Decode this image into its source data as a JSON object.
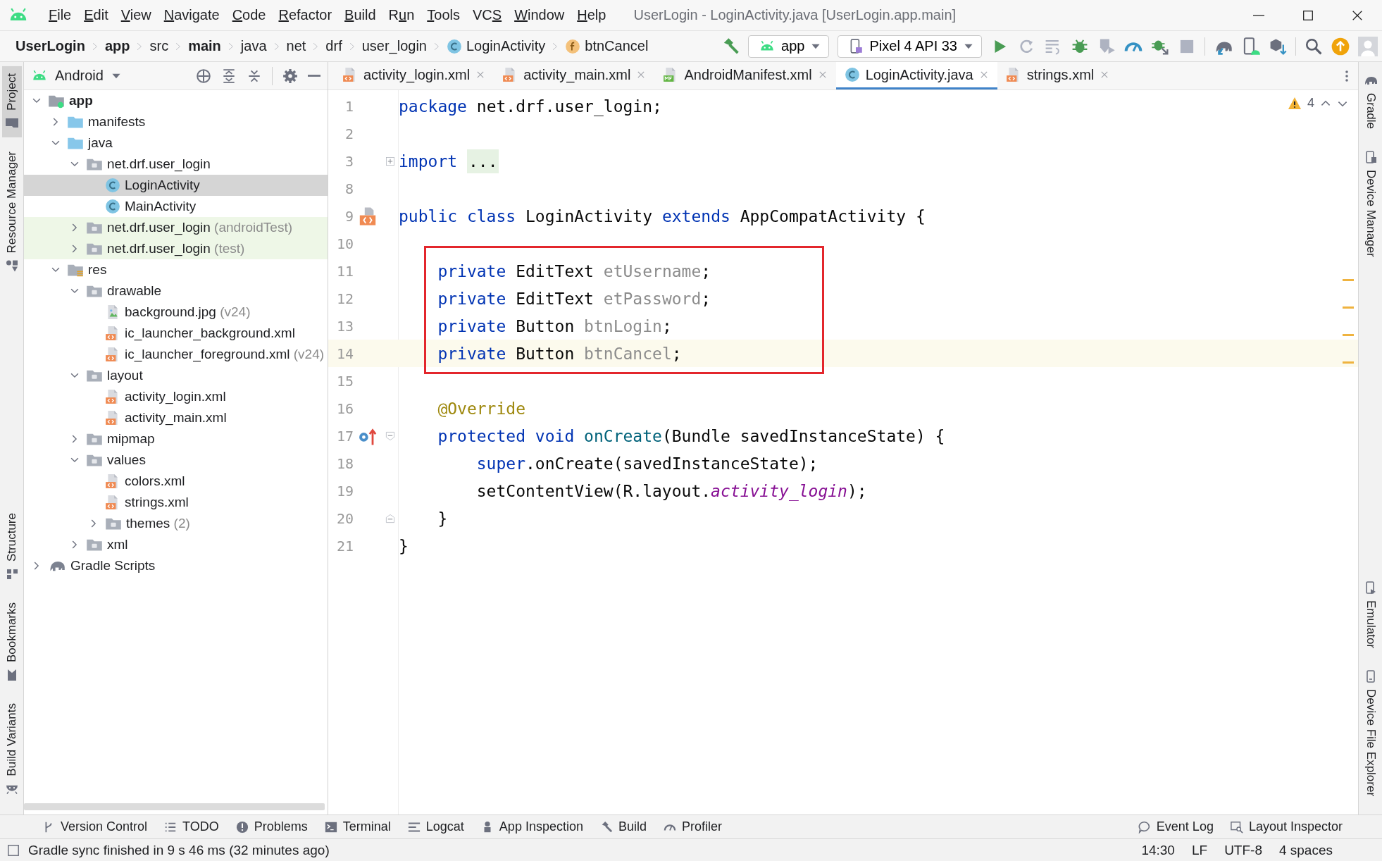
{
  "window": {
    "title": "UserLogin - LoginActivity.java [UserLogin.app.main]"
  },
  "menu": [
    {
      "parts": [
        {
          "text": "F",
          "underlined": true
        },
        {
          "text": "ile",
          "underlined": false
        }
      ]
    },
    {
      "parts": [
        {
          "text": "E",
          "underlined": true
        },
        {
          "text": "dit",
          "underlined": false
        }
      ]
    },
    {
      "parts": [
        {
          "text": "V",
          "underlined": true
        },
        {
          "text": "iew",
          "underlined": false
        }
      ]
    },
    {
      "parts": [
        {
          "text": "N",
          "underlined": true
        },
        {
          "text": "avigate",
          "underlined": false
        }
      ]
    },
    {
      "parts": [
        {
          "text": "C",
          "underlined": true
        },
        {
          "text": "ode",
          "underlined": false
        }
      ]
    },
    {
      "parts": [
        {
          "text": "R",
          "underlined": true
        },
        {
          "text": "efactor",
          "underlined": false
        }
      ]
    },
    {
      "parts": [
        {
          "text": "B",
          "underlined": true
        },
        {
          "text": "uild",
          "underlined": false
        }
      ]
    },
    {
      "parts": [
        {
          "text": "R",
          "underlined": false
        },
        {
          "text": "u",
          "underlined": true
        },
        {
          "text": "n",
          "underlined": false
        }
      ]
    },
    {
      "parts": [
        {
          "text": "T",
          "underlined": true
        },
        {
          "text": "ools",
          "underlined": false
        }
      ]
    },
    {
      "parts": [
        {
          "text": "VC",
          "underlined": false
        },
        {
          "text": "S",
          "underlined": true
        }
      ]
    },
    {
      "parts": [
        {
          "text": "W",
          "underlined": true
        },
        {
          "text": "indow",
          "underlined": false
        }
      ]
    },
    {
      "parts": [
        {
          "text": "H",
          "underlined": true
        },
        {
          "text": "elp",
          "underlined": false
        }
      ]
    }
  ],
  "breadcrumbs": [
    {
      "label": "UserLogin",
      "kind": "plain",
      "bold": true
    },
    {
      "label": "app",
      "kind": "plain",
      "bold": true
    },
    {
      "label": "src",
      "kind": "plain",
      "bold": false
    },
    {
      "label": "main",
      "kind": "plain",
      "bold": true
    },
    {
      "label": "java",
      "kind": "plain",
      "bold": false
    },
    {
      "label": "net",
      "kind": "plain",
      "bold": false
    },
    {
      "label": "drf",
      "kind": "plain",
      "bold": false
    },
    {
      "label": "user_login",
      "kind": "plain",
      "bold": false
    },
    {
      "label": "LoginActivity",
      "kind": "class",
      "bold": false
    },
    {
      "label": "btnCancel",
      "kind": "field",
      "bold": false
    }
  ],
  "toolbar": [
    {
      "kind": "hammer",
      "disabled": false
    },
    {
      "kind": "module-config",
      "label": "app"
    },
    {
      "kind": "device-config",
      "label": "Pixel 4 API 33"
    },
    {
      "kind": "run",
      "disabled": false
    },
    {
      "kind": "rerun",
      "disabled": true
    },
    {
      "kind": "apply",
      "disabled": true
    },
    {
      "kind": "debug",
      "disabled": false
    },
    {
      "kind": "attach",
      "disabled": true
    },
    {
      "kind": "profile",
      "disabled": false
    },
    {
      "kind": "attach-debugger",
      "disabled": false
    },
    {
      "kind": "stop",
      "disabled": true
    },
    {
      "kind": "separator"
    },
    {
      "kind": "sync",
      "disabled": false
    },
    {
      "kind": "device-manager",
      "disabled": false
    },
    {
      "kind": "sdk",
      "disabled": false
    },
    {
      "kind": "separator"
    },
    {
      "kind": "search",
      "disabled": false
    },
    {
      "kind": "update",
      "disabled": false
    },
    {
      "kind": "account",
      "disabled": false
    }
  ],
  "left_strip": {
    "top": [
      {
        "label": "Project",
        "kind": "project",
        "selected": true
      },
      {
        "label": "Resource Manager",
        "kind": "resources",
        "selected": false
      }
    ],
    "bottom": [
      {
        "label": "Structure",
        "kind": "structure",
        "selected": false
      },
      {
        "label": "Bookmarks",
        "kind": "bookmarks",
        "selected": false
      },
      {
        "label": "Build Variants",
        "kind": "variants",
        "selected": false
      }
    ]
  },
  "right_strip": {
    "top": [
      {
        "label": "Gradle",
        "kind": "gradle",
        "selected": false
      },
      {
        "label": "Device Manager",
        "kind": "device",
        "selected": false
      }
    ],
    "bottom": [
      {
        "label": "Emulator",
        "kind": "emulator",
        "selected": false
      },
      {
        "label": "Device File Explorer",
        "kind": "files",
        "selected": false
      }
    ]
  },
  "project": {
    "view": "Android",
    "tree": [
      {
        "label": "app",
        "kind": "module",
        "bold": true,
        "expanded": true,
        "selected": false,
        "test": false,
        "children": [
          {
            "label": "manifests",
            "kind": "folder",
            "bold": false,
            "expanded": false,
            "selected": false,
            "test": false
          },
          {
            "label": "java",
            "kind": "folder",
            "bold": false,
            "expanded": true,
            "selected": false,
            "test": false,
            "children": [
              {
                "label": "net.drf.user_login",
                "kind": "package",
                "bold": false,
                "expanded": true,
                "selected": false,
                "test": false,
                "children": [
                  {
                    "label": "LoginActivity",
                    "kind": "class",
                    "bold": false,
                    "selected": true,
                    "test": false
                  },
                  {
                    "label": "MainActivity",
                    "kind": "class",
                    "bold": false,
                    "selected": false,
                    "test": false
                  }
                ]
              },
              {
                "label": "net.drf.user_login",
                "suffix": "(androidTest)",
                "kind": "package",
                "bold": false,
                "expanded": false,
                "selected": false,
                "test": true
              },
              {
                "label": "net.drf.user_login",
                "suffix": "(test)",
                "kind": "package",
                "bold": false,
                "expanded": false,
                "selected": false,
                "test": true
              }
            ]
          },
          {
            "label": "res",
            "kind": "resources",
            "bold": false,
            "expanded": true,
            "selected": false,
            "test": false,
            "children": [
              {
                "label": "drawable",
                "kind": "package",
                "bold": false,
                "expanded": true,
                "selected": false,
                "test": false,
                "children": [
                  {
                    "label": "background.jpg",
                    "suffix": "(v24)",
                    "kind": "image",
                    "bold": false,
                    "selected": false,
                    "test": false
                  },
                  {
                    "label": "ic_launcher_background.xml",
                    "kind": "xml",
                    "bold": false,
                    "selected": false,
                    "test": false
                  },
                  {
                    "label": "ic_launcher_foreground.xml",
                    "suffix": "(v24)",
                    "kind": "xml",
                    "bold": false,
                    "selected": false,
                    "test": false
                  }
                ]
              },
              {
                "label": "layout",
                "kind": "package",
                "bold": false,
                "expanded": true,
                "selected": false,
                "test": false,
                "children": [
                  {
                    "label": "activity_login.xml",
                    "kind": "xml",
                    "bold": false,
                    "selected": false,
                    "test": false
                  },
                  {
                    "label": "activity_main.xml",
                    "kind": "xml",
                    "bold": false,
                    "selected": false,
                    "test": false
                  }
                ]
              },
              {
                "label": "mipmap",
                "kind": "package",
                "bold": false,
                "expanded": false,
                "selected": false,
                "test": false
              },
              {
                "label": "values",
                "kind": "package",
                "bold": false,
                "expanded": true,
                "selected": false,
                "test": false,
                "children": [
                  {
                    "label": "colors.xml",
                    "kind": "xml",
                    "bold": false,
                    "selected": false,
                    "test": false
                  },
                  {
                    "label": "strings.xml",
                    "kind": "xml",
                    "bold": false,
                    "selected": false,
                    "test": false
                  },
                  {
                    "label": "themes",
                    "suffix": "(2)",
                    "kind": "package",
                    "bold": false,
                    "expanded": false,
                    "selected": false,
                    "test": false
                  }
                ]
              },
              {
                "label": "xml",
                "kind": "package",
                "bold": false,
                "expanded": false,
                "selected": false,
                "test": false
              }
            ]
          }
        ]
      },
      {
        "label": "Gradle Scripts",
        "kind": "gradle",
        "bold": false,
        "expanded": false,
        "selected": false,
        "test": false
      }
    ]
  },
  "tabs": [
    {
      "label": "activity_login.xml",
      "kind": "xml",
      "selected": false
    },
    {
      "label": "activity_main.xml",
      "kind": "xml",
      "selected": false
    },
    {
      "label": "AndroidManifest.xml",
      "kind": "manifest",
      "selected": false
    },
    {
      "label": "LoginActivity.java",
      "kind": "class",
      "selected": true
    },
    {
      "label": "strings.xml",
      "kind": "xml",
      "selected": false
    }
  ],
  "editor": {
    "warnings_count": "4",
    "lines": [
      {
        "number": "1",
        "current": false,
        "boxed": false,
        "warning": false,
        "tokens": [
          {
            "kind": "keyword",
            "text": "package"
          },
          {
            "kind": "plain",
            "text": " net.drf.user_login;"
          }
        ]
      },
      {
        "number": "2",
        "current": false,
        "boxed": false,
        "warning": false
      },
      {
        "number": "3",
        "current": false,
        "boxed": false,
        "warning": false,
        "fold": {
          "kind": "folded"
        },
        "tokens": [
          {
            "kind": "keyword",
            "text": "import "
          },
          {
            "kind": "folded",
            "text": "..."
          }
        ]
      },
      {
        "number": "8",
        "current": false,
        "boxed": false,
        "warning": false
      },
      {
        "number": "9",
        "current": false,
        "boxed": false,
        "warning": false,
        "gutter": {
          "kind": "implemented"
        },
        "tokens": [
          {
            "kind": "keyword",
            "text": "public class"
          },
          {
            "kind": "plain",
            "text": " LoginActivity "
          },
          {
            "kind": "keyword",
            "text": "extends"
          },
          {
            "kind": "plain",
            "text": " AppCompatActivity {"
          }
        ]
      },
      {
        "number": "10",
        "current": false,
        "boxed": false,
        "warning": false
      },
      {
        "number": "11",
        "current": false,
        "boxed": true,
        "warning": true,
        "tokens": [
          {
            "kind": "keyword",
            "text": "    private"
          },
          {
            "kind": "plain",
            "text": " EditText "
          },
          {
            "kind": "unused",
            "text": "etUsername"
          },
          {
            "kind": "plain",
            "text": ";"
          }
        ]
      },
      {
        "number": "12",
        "current": false,
        "boxed": true,
        "warning": true,
        "tokens": [
          {
            "kind": "keyword",
            "text": "    private"
          },
          {
            "kind": "plain",
            "text": " EditText "
          },
          {
            "kind": "unused",
            "text": "etPassword"
          },
          {
            "kind": "plain",
            "text": ";"
          }
        ]
      },
      {
        "number": "13",
        "current": false,
        "boxed": true,
        "warning": true,
        "tokens": [
          {
            "kind": "keyword",
            "text": "    private"
          },
          {
            "kind": "plain",
            "text": " Button "
          },
          {
            "kind": "unused",
            "text": "btnLogin"
          },
          {
            "kind": "plain",
            "text": ";"
          }
        ]
      },
      {
        "number": "14",
        "current": true,
        "boxed": true,
        "warning": true,
        "tokens": [
          {
            "kind": "keyword",
            "text": "    private"
          },
          {
            "kind": "plain",
            "text": " Button "
          },
          {
            "kind": "unused",
            "text": "btnCancel"
          },
          {
            "kind": "plain",
            "text": ";"
          }
        ]
      },
      {
        "number": "15",
        "current": false,
        "boxed": false,
        "warning": false
      },
      {
        "number": "16",
        "current": false,
        "boxed": false,
        "warning": false,
        "tokens": [
          {
            "kind": "annotation",
            "text": "    @Override"
          }
        ]
      },
      {
        "number": "17",
        "current": false,
        "boxed": false,
        "warning": false,
        "gutter": {
          "kind": "overrides"
        },
        "fold": {
          "kind": "open"
        },
        "tokens": [
          {
            "kind": "keyword",
            "text": "    protected void "
          },
          {
            "kind": "method",
            "text": "onCreate"
          },
          {
            "kind": "plain",
            "text": "(Bundle savedInstanceState) {"
          }
        ]
      },
      {
        "number": "18",
        "current": false,
        "boxed": false,
        "warning": false,
        "tokens": [
          {
            "kind": "keyword",
            "text": "        super"
          },
          {
            "kind": "plain",
            "text": ".onCreate(savedInstanceState);"
          }
        ]
      },
      {
        "number": "19",
        "current": false,
        "boxed": false,
        "warning": false,
        "tokens": [
          {
            "kind": "plain",
            "text": "        setContentView(R.layout."
          },
          {
            "kind": "static",
            "text": "activity_login"
          },
          {
            "kind": "plain",
            "text": ");"
          }
        ]
      },
      {
        "number": "20",
        "current": false,
        "boxed": false,
        "warning": false,
        "fold": {
          "kind": "close"
        },
        "tokens": [
          {
            "kind": "plain",
            "text": "    }"
          }
        ]
      },
      {
        "number": "21",
        "current": false,
        "boxed": false,
        "warning": false,
        "tokens": [
          {
            "kind": "plain",
            "text": "}"
          }
        ]
      }
    ]
  },
  "bottom_bar": {
    "left": [
      {
        "label": "Version Control",
        "kind": "vcs"
      },
      {
        "label": "TODO",
        "kind": "todo"
      },
      {
        "label": "Problems",
        "kind": "problems"
      },
      {
        "label": "Terminal",
        "kind": "terminal"
      },
      {
        "label": "Logcat",
        "kind": "logcat"
      },
      {
        "label": "App Inspection",
        "kind": "inspection"
      },
      {
        "label": "Build",
        "kind": "build"
      },
      {
        "label": "Profiler",
        "kind": "profiler"
      }
    ],
    "right": [
      {
        "label": "Event Log",
        "kind": "event-log"
      },
      {
        "label": "Layout Inspector",
        "kind": "layout-inspector"
      }
    ]
  },
  "status_bar": {
    "message": "Gradle sync finished in 9 s 46 ms (32 minutes ago)",
    "items": [
      "14:30",
      "LF",
      "UTF-8",
      "4 spaces"
    ]
  }
}
